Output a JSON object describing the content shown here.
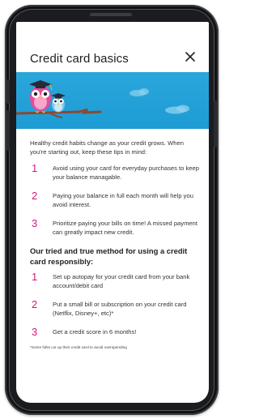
{
  "dialog": {
    "title": "Credit card basics",
    "close_label": "close"
  },
  "intro": "Healthy credit habits change as your credit grows. When you're starting out, keep these tips in mind:",
  "tips": [
    {
      "number": "1",
      "text": "Avoid using your card for everyday purchases to keep your balance managable."
    },
    {
      "number": "2",
      "text": "Paying your balance in full each month will help you avoid interest."
    },
    {
      "number": "3",
      "text": "Prioritize paying your bills on time! A missed payment can greatly impact new credit."
    }
  ],
  "method_heading": "Our tried and true method for using a credit card responsibly:",
  "method_steps": [
    {
      "number": "1",
      "text": "Set up autopay for your credit card from your bank account/debit card"
    },
    {
      "number": "2",
      "text": "Put a small bill or subscription on your credit card (Netflix, Disney+, etc)*"
    },
    {
      "number": "3",
      "text": "Get a credit score in 6 months!"
    }
  ],
  "footnote": "*Some folks cut up their credit card to avoid overspending",
  "colors": {
    "accent_pink": "#d6187e",
    "hero_blue": "#1d9bd4",
    "branch_brown": "#8a4a32"
  },
  "icons": {
    "hero": "owls-on-branch-illustration",
    "close": "close-icon"
  }
}
